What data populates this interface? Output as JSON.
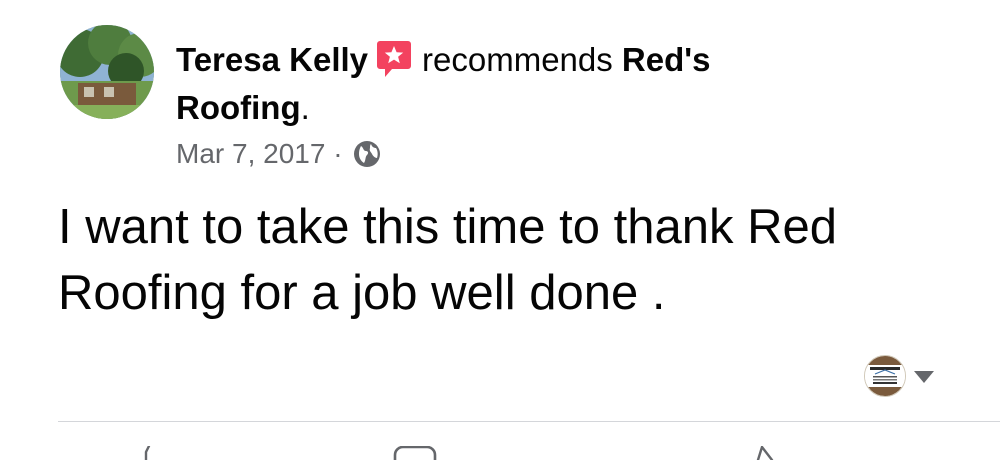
{
  "post": {
    "author": "Teresa Kelly",
    "recommends_text": "recommends",
    "page_name_part1": "Red's",
    "page_name_part2": "Roofing",
    "period": ".",
    "date": "Mar 7, 2017",
    "separator": "·",
    "privacy_icon": "globe-icon",
    "recommend_icon": "star-speech-bubble-icon",
    "body_line1": "I want to take this time to thank Red",
    "body_line2": "Roofing for a job well done ."
  },
  "colors": {
    "recommend_badge": "#f3425f",
    "meta_text": "#65676b",
    "divider": "#d4d6da"
  }
}
